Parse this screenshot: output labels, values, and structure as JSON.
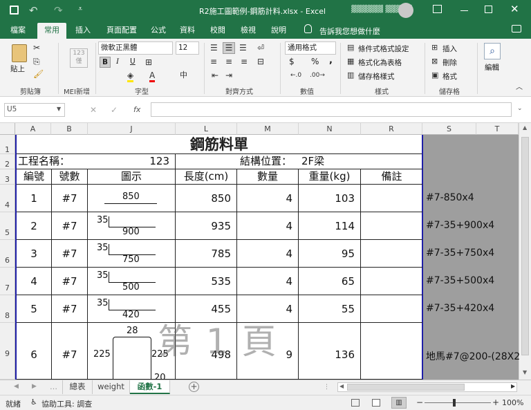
{
  "titlebar": {
    "title": "R2施工圖範例-鋼筋計料.xlsx - Excel",
    "user": "▓▓▓▓▓▓ ▓▓▓▓▓",
    "save_icon": "save-icon",
    "undo_icon": "undo-icon",
    "redo_icon": "redo-icon"
  },
  "tabs": [
    "檔案",
    "常用",
    "插入",
    "頁面配置",
    "公式",
    "資料",
    "校閱",
    "檢視",
    "說明"
  ],
  "tellme": "告訴我您想做什麼",
  "ribbon": {
    "paste": "貼上",
    "mei_icon": "123\n僅",
    "font_name": "微軟正黑體",
    "font_size": "12",
    "bold": "B",
    "italic": "I",
    "underline": "U",
    "number_format": "通用格式",
    "currency": "$",
    "percent": "%",
    "comma": ",",
    "cond_format": "條件式格式設定",
    "as_table": "格式化為表格",
    "cell_styles": "儲存格樣式",
    "insert": "插入",
    "delete": "刪除",
    "format": "格式",
    "editing": "編輯",
    "groups": {
      "clipboard": "剪貼簿",
      "mei": "MEI新增",
      "font": "字型",
      "align": "對齊方式",
      "number": "數值",
      "styles": "樣式",
      "cells": "儲存格"
    }
  },
  "formula_bar": {
    "name_box": "U5",
    "fx": "fx",
    "value": ""
  },
  "columns": [
    "A",
    "B",
    "J",
    "L",
    "M",
    "N",
    "R",
    "S",
    "T"
  ],
  "rows": [
    "1",
    "2",
    "3",
    "4",
    "5",
    "6",
    "7",
    "8",
    "9"
  ],
  "sheet": {
    "title": "鋼筋料單",
    "project_label": "工程名稱：",
    "project_value": "123",
    "location_label": "結構位置：",
    "location_value": "2F梁",
    "headers": [
      "編號",
      "號數",
      "圖示",
      "長度(cm)",
      "數量",
      "重量(kg)",
      "備註"
    ],
    "rows": [
      {
        "no": "1",
        "size": "#7",
        "fig_top": "",
        "fig_main": "850",
        "length": "850",
        "qty": "4",
        "weight": "103",
        "note": "#7-850x4"
      },
      {
        "no": "2",
        "size": "#7",
        "fig_top": "35",
        "fig_main": "900",
        "length": "935",
        "qty": "4",
        "weight": "114",
        "note": "#7-35+900x4"
      },
      {
        "no": "3",
        "size": "#7",
        "fig_top": "35",
        "fig_main": "750",
        "length": "785",
        "qty": "4",
        "weight": "95",
        "note": "#7-35+750x4"
      },
      {
        "no": "4",
        "size": "#7",
        "fig_top": "35",
        "fig_main": "500",
        "length": "535",
        "qty": "4",
        "weight": "65",
        "note": "#7-35+500x4"
      },
      {
        "no": "5",
        "size": "#7",
        "fig_top": "35",
        "fig_main": "420",
        "length": "455",
        "qty": "4",
        "weight": "55",
        "note": "#7-35+420x4"
      },
      {
        "no": "6",
        "size": "#7",
        "fig_top": "28",
        "fig_left": "225",
        "fig_right": "225",
        "fig_bottom": "20",
        "length": "498",
        "qty": "9",
        "weight": "136",
        "note": "地馬#7@200-(28X2"
      }
    ],
    "watermark": "第 1 頁"
  },
  "sheet_tabs": [
    "總表",
    "weight",
    "函數-1"
  ],
  "status": {
    "ready": "就緒",
    "accessibility": "協助工具: 調查",
    "zoom": "100%"
  },
  "colors": {
    "excel_green": "#217346",
    "page_border": "#1f1fa8",
    "grey_area": "#9e9e9e"
  }
}
